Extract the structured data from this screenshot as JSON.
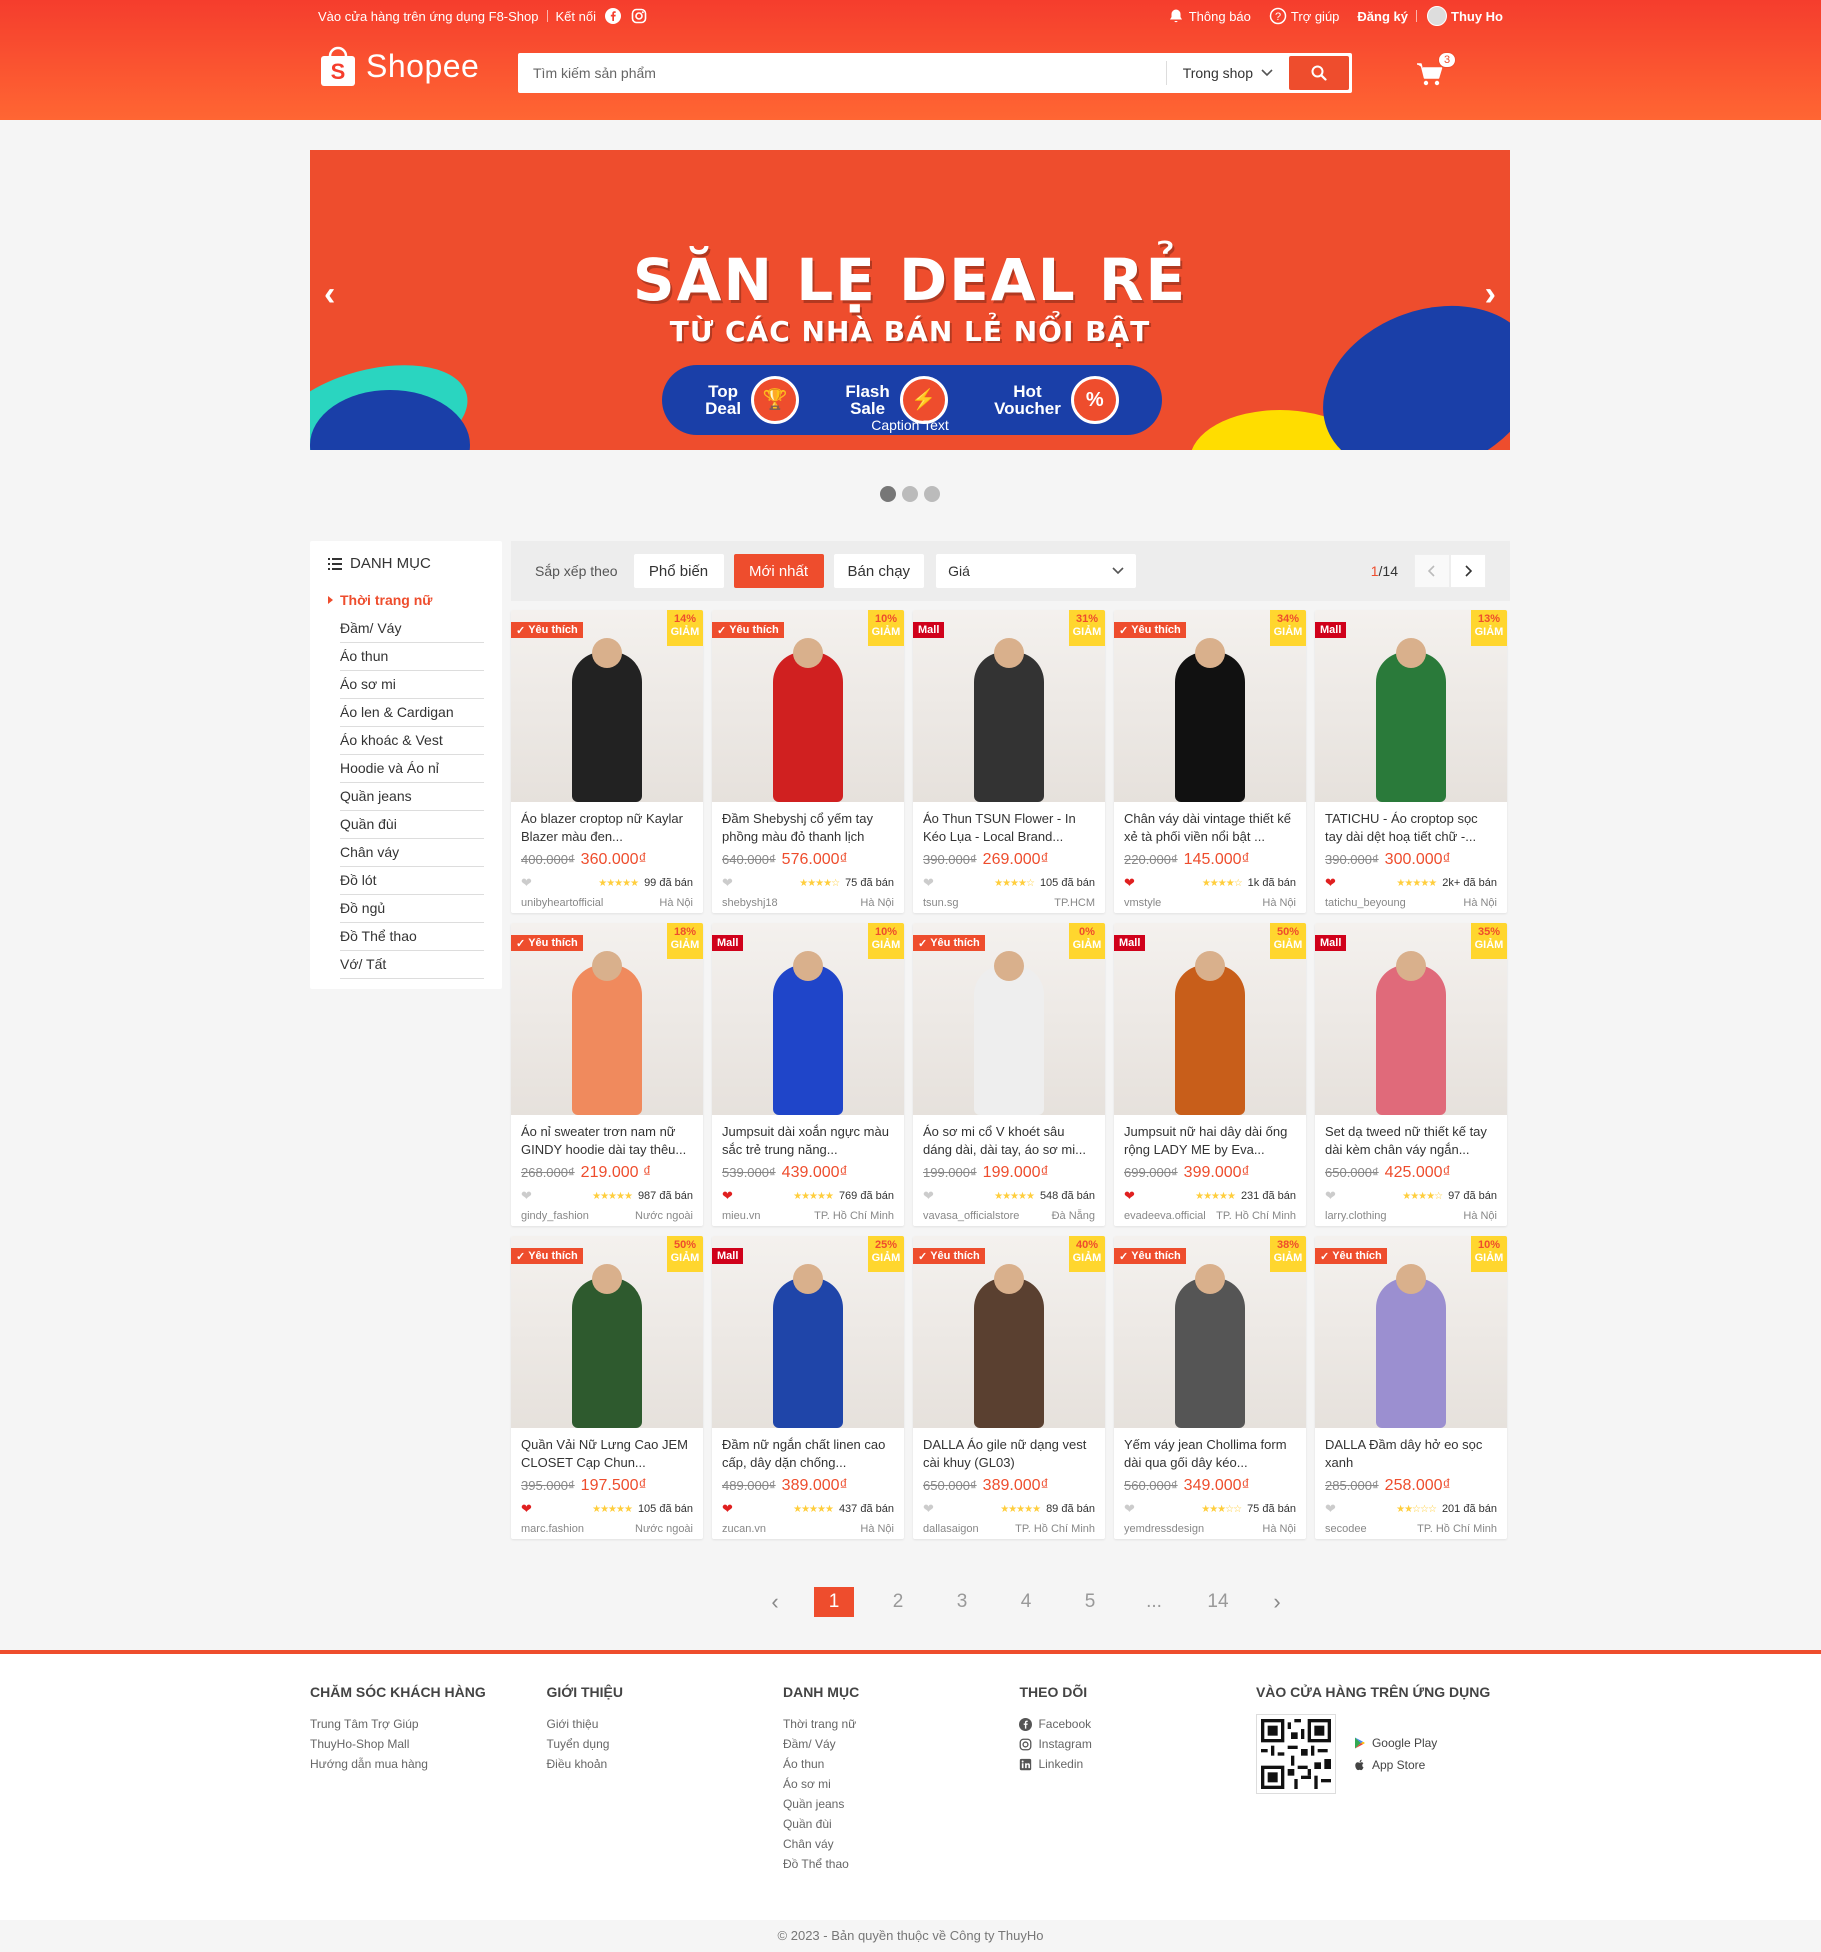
{
  "topbar": {
    "store_app": "Vào cửa hàng trên ứng dụng F8-Shop",
    "connect": "Kết nối",
    "notifications": "Thông báo",
    "help": "Trợ giúp",
    "register": "Đăng ký",
    "username": "Thuy Ho"
  },
  "header": {
    "logo_text": "Shopee",
    "search_placeholder": "Tìm kiếm sản phẩm",
    "search_scope": "Trong shop",
    "cart_count": "3"
  },
  "banner": {
    "headline": "SĂN LẸ DEAL RẺ",
    "subline": "TỪ CÁC NHÀ BÁN LẺ NỔI BẬT",
    "deals": [
      {
        "line1": "Top",
        "line2": "Deal"
      },
      {
        "line1": "Flash",
        "line2": "Sale"
      },
      {
        "line1": "Hot",
        "line2": "Voucher"
      }
    ],
    "caption": "Caption Text",
    "prev": "‹",
    "next": "›"
  },
  "sidebar": {
    "title": "DANH MỤC",
    "items": [
      "Thời trang nữ",
      "Đầm/ Váy",
      "Áo thun",
      "Áo sơ mi",
      "Áo len & Cardigan",
      "Áo khoác & Vest",
      "Hoodie và Áo nỉ",
      "Quần jeans",
      "Quần đùi",
      "Chân váy",
      "Đồ lót",
      "Đồ ngủ",
      "Đồ Thể thao",
      "Vớ/ Tất"
    ]
  },
  "sortbar": {
    "label": "Sắp xếp theo",
    "popular": "Phổ biến",
    "newest": "Mới nhất",
    "bestseller": "Bán chạy",
    "price": "Giá",
    "page_current": "1",
    "page_total": "/14"
  },
  "products": [
    {
      "tag": "Yêu thích",
      "disc": "14%",
      "name": "Áo blazer croptop nữ Kaylar Blazer màu đen...",
      "old": "400.000₫",
      "new": "360.000₫",
      "liked": false,
      "stars": 5,
      "sold": "99 đã bán",
      "shop": "unibyheartofficial",
      "loc": "Hà Nội",
      "color": "#222"
    },
    {
      "tag": "Yêu thích",
      "disc": "10%",
      "name": "Đầm Shebyshj cổ yếm tay phồng màu đỏ thanh lịch",
      "old": "640.000₫",
      "new": "576.000₫",
      "liked": false,
      "stars": 4,
      "sold": "75 đã bán",
      "shop": "shebyshj18",
      "loc": "Hà Nội",
      "color": "#d02020"
    },
    {
      "tag": "Mall",
      "disc": "31%",
      "name": "Áo Thun TSUN Flower - In Kéo Lụa - Local Brand...",
      "old": "390.000₫",
      "new": "269.000₫",
      "liked": false,
      "stars": 4,
      "sold": "105 đã bán",
      "shop": "tsun.sg",
      "loc": "TP.HCM",
      "color": "#333"
    },
    {
      "tag": "Yêu thích",
      "disc": "34%",
      "name": "Chân váy dài vintage thiết kế xẻ tà phối viền nổi bật ...",
      "old": "220.000₫",
      "new": "145.000₫",
      "liked": true,
      "stars": 4,
      "sold": "1k đã bán",
      "shop": "vmstyle",
      "loc": "Hà Nội",
      "color": "#111"
    },
    {
      "tag": "Mall",
      "disc": "13%",
      "name": "TATICHU - Áo croptop sọc tay dài dệt hoạ tiết chữ -...",
      "old": "390.000₫",
      "new": "300.000₫",
      "liked": true,
      "stars": 5,
      "sold": "2k+ đã bán",
      "shop": "tatichu_beyoung",
      "loc": "Hà Nội",
      "color": "#2a7a3a"
    },
    {
      "tag": "Yêu thích",
      "disc": "18%",
      "name": "Áo nỉ sweater trơn nam nữ GINDY hoodie dài tay thêu...",
      "old": "268.000₫",
      "new": "219.000 ₫",
      "liked": false,
      "stars": 5,
      "sold": "987 đã bán",
      "shop": "gindy_fashion",
      "loc": "Nước ngoài",
      "color": "#f08a5d"
    },
    {
      "tag": "Mall",
      "disc": "10%",
      "name": "Jumpsuit dài xoắn ngực màu sắc trẻ trung năng...",
      "old": "539.000₫",
      "new": "439.000₫",
      "liked": true,
      "stars": 5,
      "sold": "769 đã bán",
      "shop": "mieu.vn",
      "loc": "TP. Hồ Chí Minh",
      "color": "#1f45c9"
    },
    {
      "tag": "Yêu thích",
      "disc": "0%",
      "name": "Áo sơ mi cổ V khoét sâu dáng dài, dài tay, áo sơ mi...",
      "old": "199.000₫",
      "new": "199.000₫",
      "liked": false,
      "stars": 5,
      "sold": "548 đã bán",
      "shop": "vavasa_officialstore",
      "loc": "Đà Nẵng",
      "color": "#eee"
    },
    {
      "tag": "Mall",
      "disc": "50%",
      "name": "Jumpsuit nữ hai dây dài ống rộng LADY ME by Eva...",
      "old": "699.000₫",
      "new": "399.000₫",
      "liked": true,
      "stars": 5,
      "sold": "231 đã bán",
      "shop": "evadeeva.official",
      "loc": "TP. Hồ Chí Minh",
      "color": "#c85e1a"
    },
    {
      "tag": "Mall",
      "disc": "35%",
      "name": "Set dạ tweed nữ thiết kế tay dài kèm chân váy ngắn...",
      "old": "650.000₫",
      "new": "425.000₫",
      "liked": false,
      "stars": 4,
      "sold": "97 đã bán",
      "shop": "larry.clothing",
      "loc": "Hà Nội",
      "color": "#e06a7a"
    },
    {
      "tag": "Yêu thích",
      "disc": "50%",
      "name": "Quần Vải Nữ Lưng Cao JEM CLOSET Cạp Chun...",
      "old": "395.000₫",
      "new": "197.500₫",
      "liked": true,
      "stars": 5,
      "sold": "105 đã bán",
      "shop": "marc.fashion",
      "loc": "Nước ngoài",
      "color": "#2e5a2e"
    },
    {
      "tag": "Mall",
      "disc": "25%",
      "name": "Đầm nữ ngắn chất linen cao cấp, dây dặn chống...",
      "old": "489.000₫",
      "new": "389.000₫",
      "liked": true,
      "stars": 5,
      "sold": "437 đã bán",
      "shop": "zucan.vn",
      "loc": "Hà Nội",
      "color": "#1f45a9"
    },
    {
      "tag": "Yêu thích",
      "disc": "40%",
      "name": "DALLA Áo gile nữ dạng vest cài khuy (GL03)",
      "old": "650.000₫",
      "new": "389.000₫",
      "liked": false,
      "stars": 5,
      "sold": "89 đã bán",
      "shop": "dallasaigon",
      "loc": "TP. Hồ Chí Minh",
      "color": "#5a4030"
    },
    {
      "tag": "Yêu thích",
      "disc": "38%",
      "name": "Yếm váy jean Chollima form dài qua gối dây kéo...",
      "old": "560.000₫",
      "new": "349.000₫",
      "liked": false,
      "stars": 3,
      "sold": "75 đã bán",
      "shop": "yemdressdesign",
      "loc": "Hà Nội",
      "color": "#555"
    },
    {
      "tag": "Yêu thích",
      "disc": "10%",
      "name": "DALLA Đầm dây hở eo sọc xanh",
      "old": "285.000₫",
      "new": "258.000₫",
      "liked": false,
      "stars": 2,
      "sold": "201 đã bán",
      "shop": "secodee",
      "loc": "TP. Hồ Chí Minh",
      "color": "#9b8fd0"
    }
  ],
  "discount_label": "GIẢM",
  "pagination": {
    "pages": [
      "1",
      "2",
      "3",
      "4",
      "5",
      "...",
      "14"
    ],
    "current": "1"
  },
  "footer": {
    "care": {
      "title": "CHĂM SÓC KHÁCH HÀNG",
      "items": [
        "Trung Tâm Trợ Giúp",
        "ThuyHo-Shop Mall",
        "Hướng dẫn mua hàng"
      ]
    },
    "about": {
      "title": "GIỚI THIỆU",
      "items": [
        "Giới thiệu",
        "Tuyển dụng",
        "Điều khoản"
      ]
    },
    "category": {
      "title": "DANH MỤC",
      "items": [
        "Thời trang nữ",
        "Đầm/ Váy",
        "Áo thun",
        "Áo sơ mi",
        "Quần jeans",
        "Quần đùi",
        "Chân váy",
        "Đồ Thể thao"
      ]
    },
    "follow": {
      "title": "THEO DÕI",
      "items": [
        "Facebook",
        "Instagram",
        "Linkedin"
      ]
    },
    "apps": {
      "title": "VÀO CỬA HÀNG TRÊN ỨNG DỤNG",
      "google": "Google Play",
      "apple": "App Store"
    }
  },
  "copyright": "© 2023 - Bản quyền thuộc về Công ty ThuyHo",
  "colors": {
    "brand": "#ee4d2d",
    "star": "#ffce3d",
    "discount_bg": "#ffd424"
  }
}
